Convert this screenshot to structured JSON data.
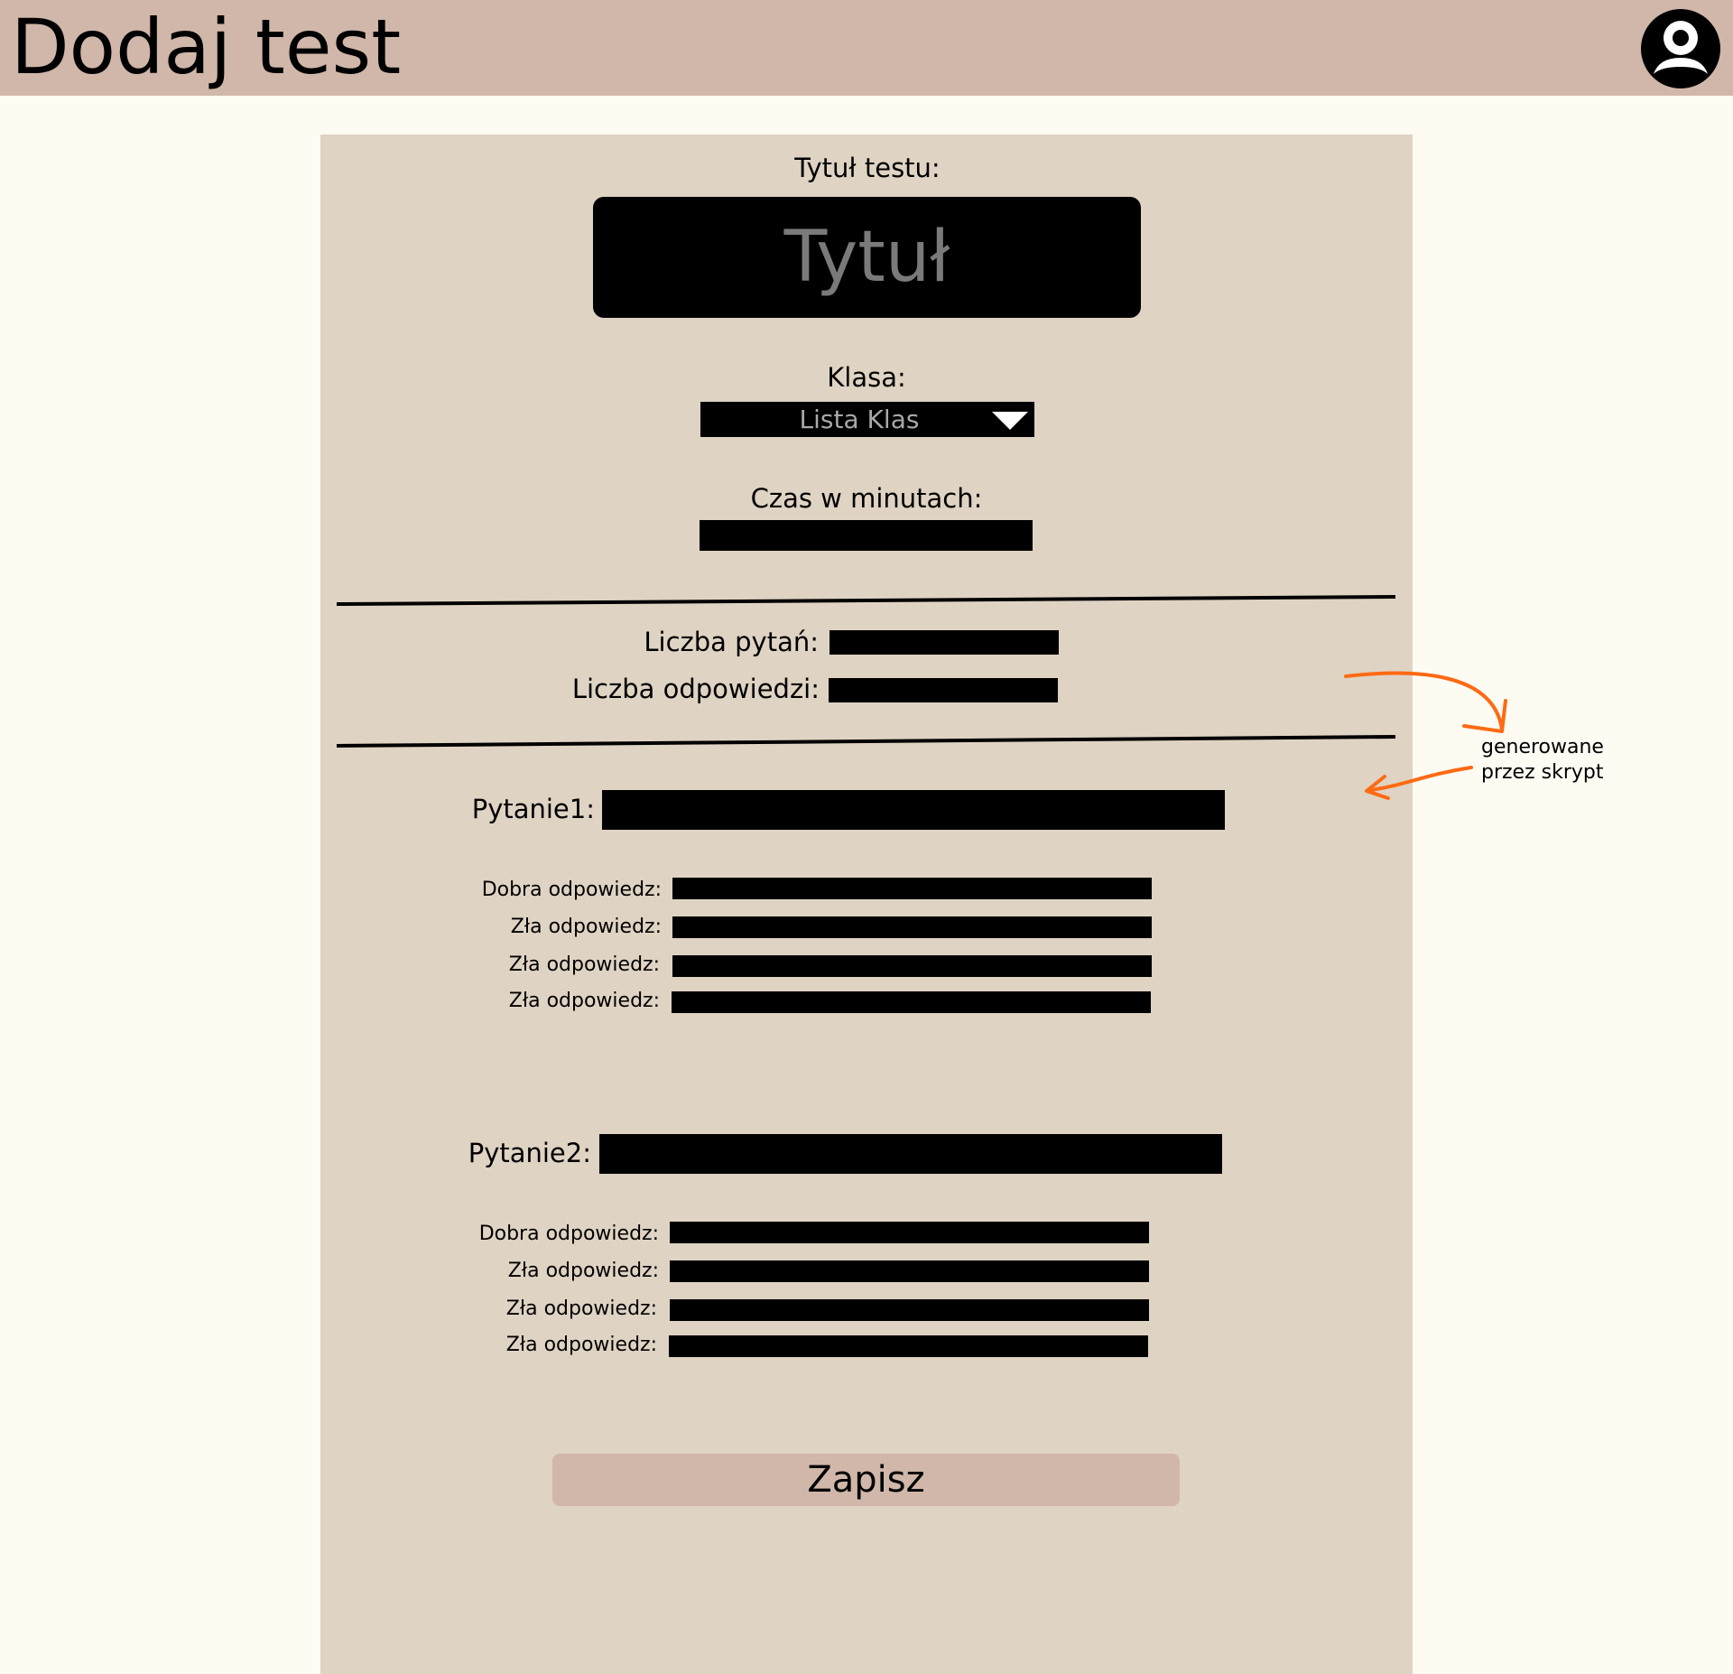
{
  "header": {
    "title": "Dodaj test",
    "avatar_icon": "user-avatar-icon"
  },
  "form": {
    "test_title": {
      "label": "Tytuł testu:",
      "placeholder": "Tytuł",
      "value": ""
    },
    "class": {
      "label": "Klasa:",
      "selected": "Lista Klas",
      "icon": "chevron-down-icon"
    },
    "time": {
      "label": "Czas w minutach:",
      "value": ""
    },
    "question_count": {
      "label": "Liczba pytań:",
      "value": ""
    },
    "answer_count": {
      "label": "Liczba odpowiedzi:",
      "value": ""
    },
    "questions": [
      {
        "label": "Pytanie1:",
        "value": "",
        "answers": [
          {
            "label": "Dobra odpowiedz:",
            "value": ""
          },
          {
            "label": "Zła odpowiedz:",
            "value": ""
          },
          {
            "label": "Zła odpowiedz:",
            "value": ""
          },
          {
            "label": "Zła odpowiedz:",
            "value": ""
          }
        ]
      },
      {
        "label": "Pytanie2:",
        "value": "",
        "answers": [
          {
            "label": "Dobra odpowiedz:",
            "value": ""
          },
          {
            "label": "Zła odpowiedz:",
            "value": ""
          },
          {
            "label": "Zła odpowiedz:",
            "value": ""
          },
          {
            "label": "Zła odpowiedz:",
            "value": ""
          }
        ]
      }
    ],
    "save_label": "Zapisz"
  },
  "annotation": {
    "text": "generowane\nprzez skrypt",
    "color": "#ff6a13"
  },
  "colors": {
    "header_bg": "#d0b7a9",
    "page_bg": "#fefbf3",
    "panel_bg": "#dfd3c3",
    "button_bg": "#d0b7a9"
  }
}
